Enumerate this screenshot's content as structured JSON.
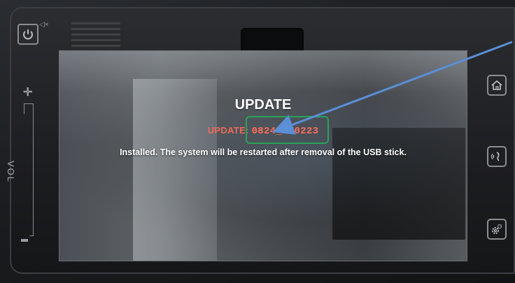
{
  "screen": {
    "title": "UPDATE",
    "update_label": "UPDATE:",
    "update_version": "0824_170223",
    "message": "Installed. The system will be restarted after removal of the USB stick."
  },
  "controls": {
    "volume_label": "VOL",
    "icons": [
      "power-icon",
      "mute-icon",
      "volume-plus-icon",
      "volume-minus-icon",
      "home-icon",
      "voice-icon",
      "settings-icon"
    ]
  },
  "annotation": {
    "highlight_color": "#27a35a",
    "arrow_color": "#5b8fd6"
  },
  "colors": {
    "title_text": "#ffffff",
    "update_line_text": "#f06a5a",
    "message_text": "#ffffff"
  }
}
